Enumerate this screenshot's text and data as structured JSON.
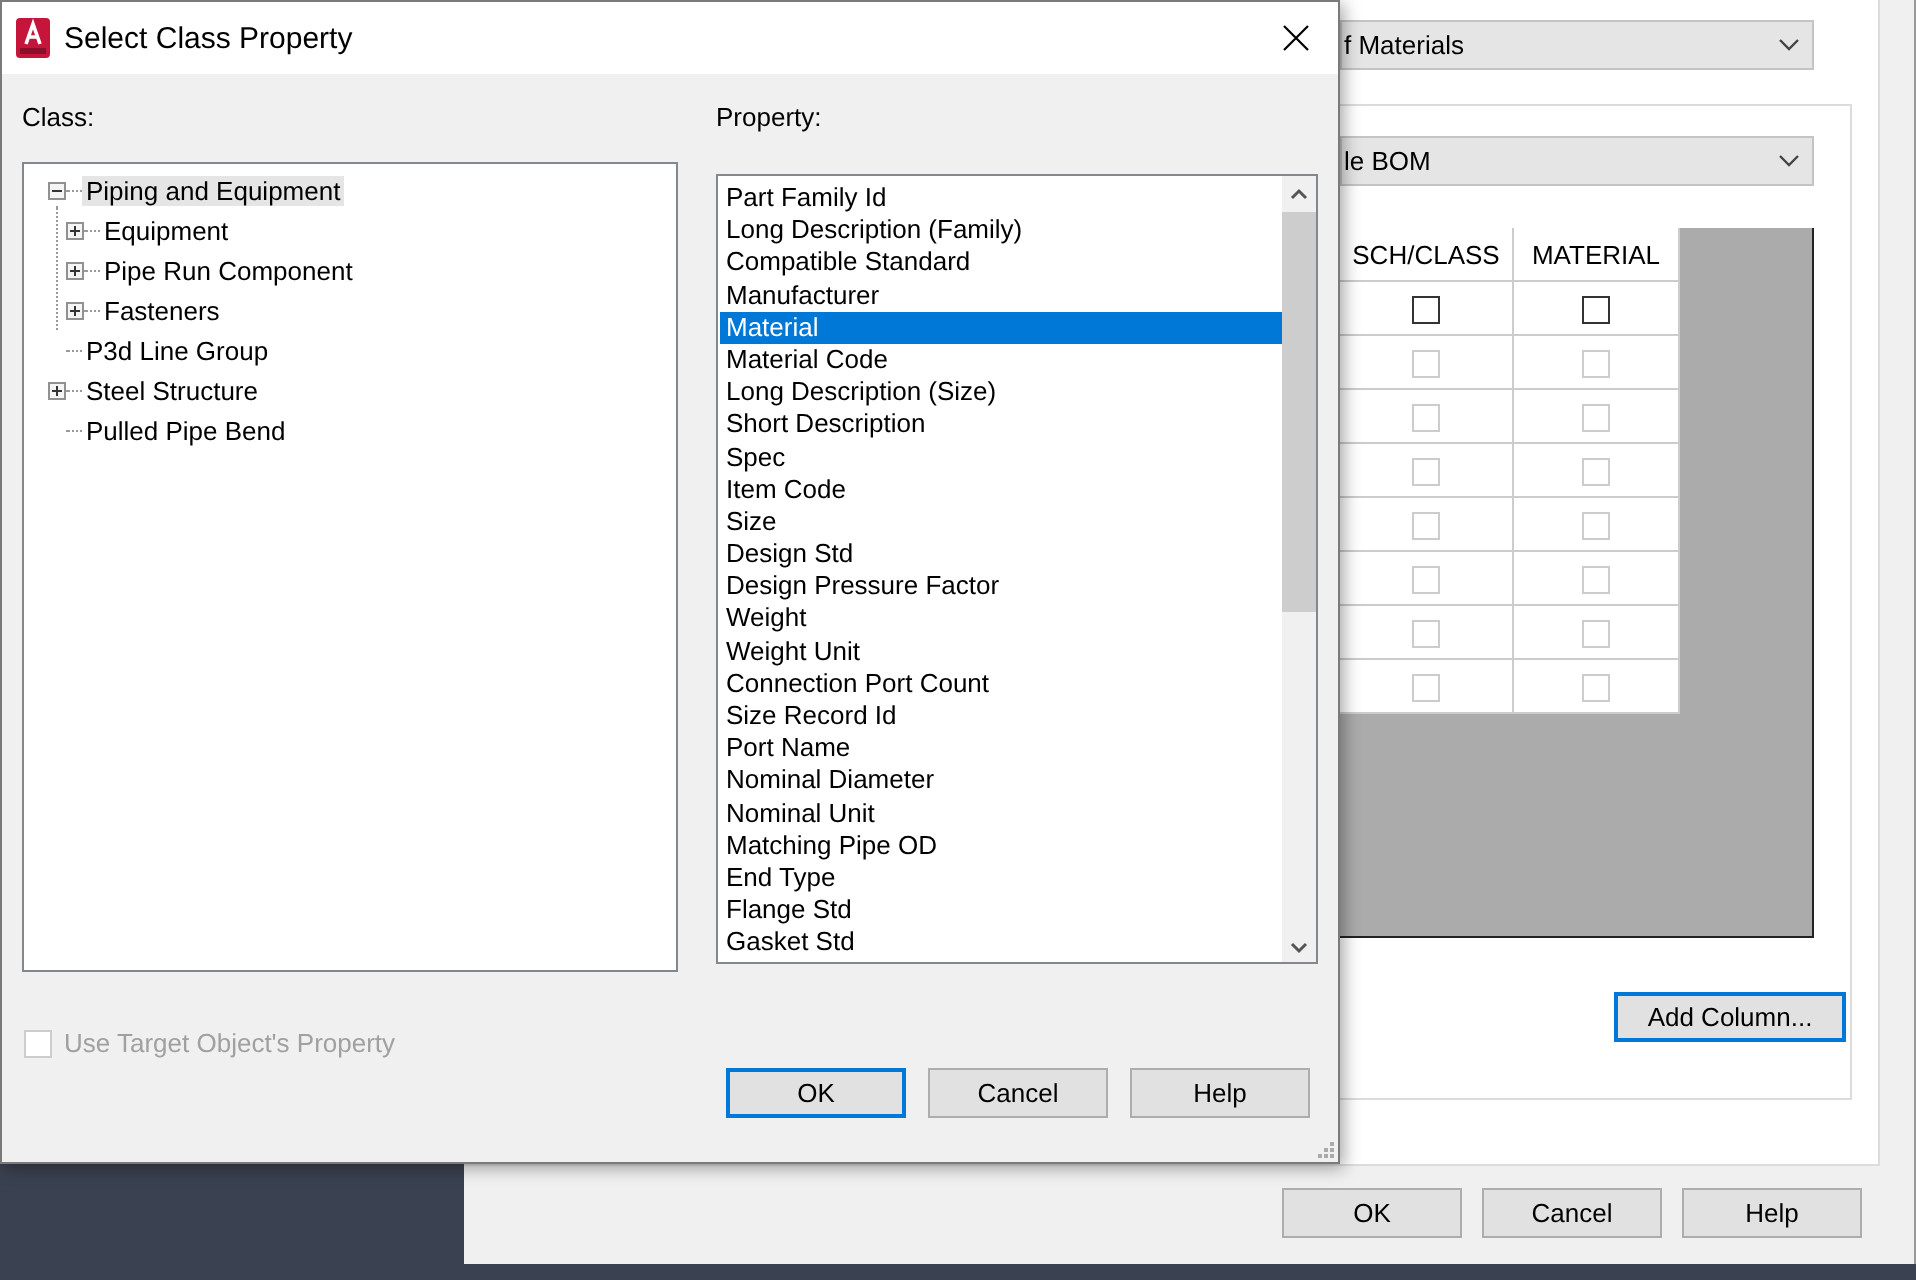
{
  "background_window": {
    "dropdowns": [
      {
        "value": "f Materials"
      },
      {
        "value": "le BOM"
      }
    ],
    "table": {
      "columns": [
        "SCH/CLASS",
        "MATERIAL"
      ],
      "rows": [
        [
          {
            "checked": false,
            "disabled": false
          },
          {
            "checked": false,
            "disabled": false
          }
        ],
        [
          {
            "checked": false,
            "disabled": true
          },
          {
            "checked": false,
            "disabled": true
          }
        ],
        [
          {
            "checked": false,
            "disabled": true
          },
          {
            "checked": false,
            "disabled": true
          }
        ],
        [
          {
            "checked": false,
            "disabled": true
          },
          {
            "checked": false,
            "disabled": true
          }
        ],
        [
          {
            "checked": false,
            "disabled": true
          },
          {
            "checked": false,
            "disabled": true
          }
        ],
        [
          {
            "checked": false,
            "disabled": true
          },
          {
            "checked": false,
            "disabled": true
          }
        ],
        [
          {
            "checked": false,
            "disabled": true
          },
          {
            "checked": false,
            "disabled": true
          }
        ],
        [
          {
            "checked": false,
            "disabled": true
          },
          {
            "checked": false,
            "disabled": true
          }
        ]
      ]
    },
    "add_column_button": {
      "label": "Add Column...",
      "focused": true
    },
    "buttons": [
      {
        "label": "OK",
        "focused": false
      },
      {
        "label": "Cancel",
        "focused": false
      },
      {
        "label": "Help",
        "focused": false
      }
    ]
  },
  "dialog": {
    "title": "Select Class Property",
    "class_label": "Class:",
    "class_tree": [
      {
        "label": "Piping and Equipment",
        "selected": true,
        "expanded": true,
        "children": [
          {
            "label": "Equipment",
            "selected": false,
            "expanded": false
          },
          {
            "label": "Pipe Run Component",
            "selected": false,
            "expanded": false
          },
          {
            "label": "Fasteners",
            "selected": false,
            "expanded": false
          }
        ]
      },
      {
        "label": "P3d Line Group",
        "selected": false
      },
      {
        "label": "Steel Structure",
        "selected": false,
        "expanded": false
      },
      {
        "label": "Pulled Pipe Bend",
        "selected": false
      }
    ],
    "property_label": "Property:",
    "properties": [
      {
        "label": "Part Family Id",
        "selected": false
      },
      {
        "label": "Long Description (Family)",
        "selected": false
      },
      {
        "label": "Compatible Standard",
        "selected": false
      },
      {
        "label": "Manufacturer",
        "selected": false
      },
      {
        "label": "Material",
        "selected": true
      },
      {
        "label": "Material Code",
        "selected": false
      },
      {
        "label": "Long Description (Size)",
        "selected": false
      },
      {
        "label": "Short Description",
        "selected": false
      },
      {
        "label": "Spec",
        "selected": false
      },
      {
        "label": "Item Code",
        "selected": false
      },
      {
        "label": "Size",
        "selected": false
      },
      {
        "label": "Design Std",
        "selected": false
      },
      {
        "label": "Design Pressure Factor",
        "selected": false
      },
      {
        "label": "Weight",
        "selected": false
      },
      {
        "label": "Weight Unit",
        "selected": false
      },
      {
        "label": "Connection Port Count",
        "selected": false
      },
      {
        "label": "Size Record Id",
        "selected": false
      },
      {
        "label": "Port Name",
        "selected": false
      },
      {
        "label": "Nominal Diameter",
        "selected": false
      },
      {
        "label": "Nominal Unit",
        "selected": false
      },
      {
        "label": "Matching Pipe OD",
        "selected": false
      },
      {
        "label": "End Type",
        "selected": false
      },
      {
        "label": "Flange Std",
        "selected": false
      },
      {
        "label": "Gasket Std",
        "selected": false
      }
    ],
    "use_target_checkbox": {
      "label": "Use Target Object's Property",
      "checked": false,
      "disabled": true
    },
    "buttons": [
      {
        "label": "OK",
        "focused": true
      },
      {
        "label": "Cancel",
        "focused": false
      },
      {
        "label": "Help",
        "focused": false
      }
    ]
  }
}
